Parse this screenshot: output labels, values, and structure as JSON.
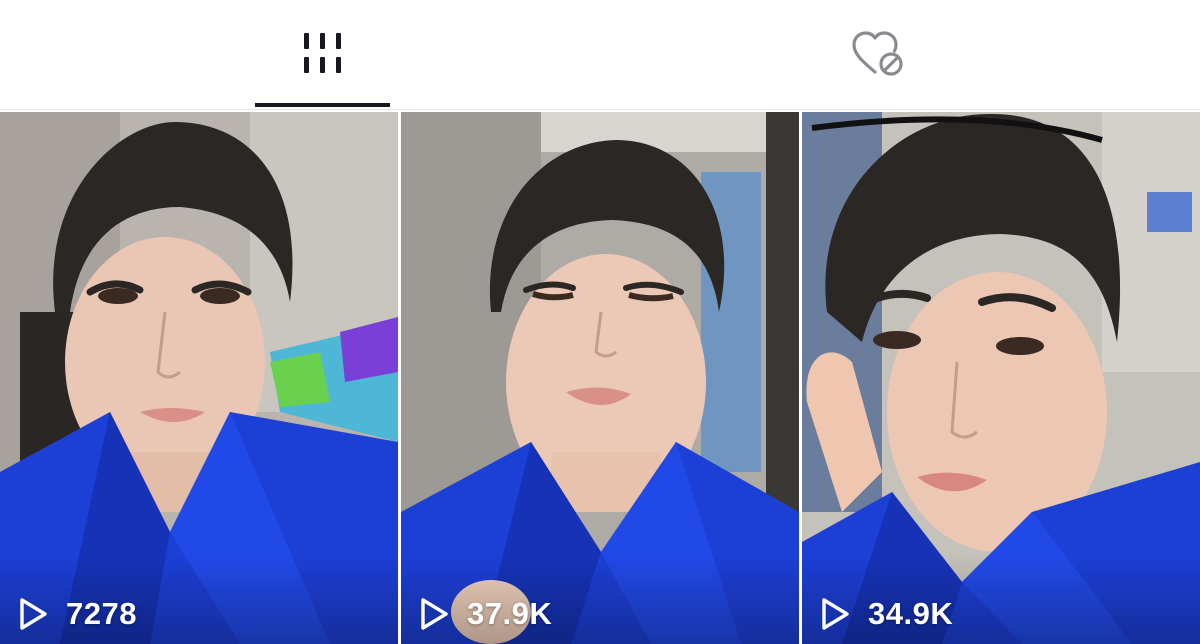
{
  "tabs": [
    {
      "icon": "videos-grid-icon",
      "active": true
    },
    {
      "icon": "liked-hidden-icon",
      "active": false
    }
  ],
  "colors": {
    "active_tab": "#161823",
    "inactive_tab": "#8a8b91",
    "shirt_blue": "#1c3fd6",
    "overlay_text": "#ffffff"
  },
  "videos": [
    {
      "views": "7278",
      "icon": "play-icon"
    },
    {
      "views": "37.9K",
      "icon": "play-icon"
    },
    {
      "views": "34.9K",
      "icon": "play-icon"
    }
  ]
}
